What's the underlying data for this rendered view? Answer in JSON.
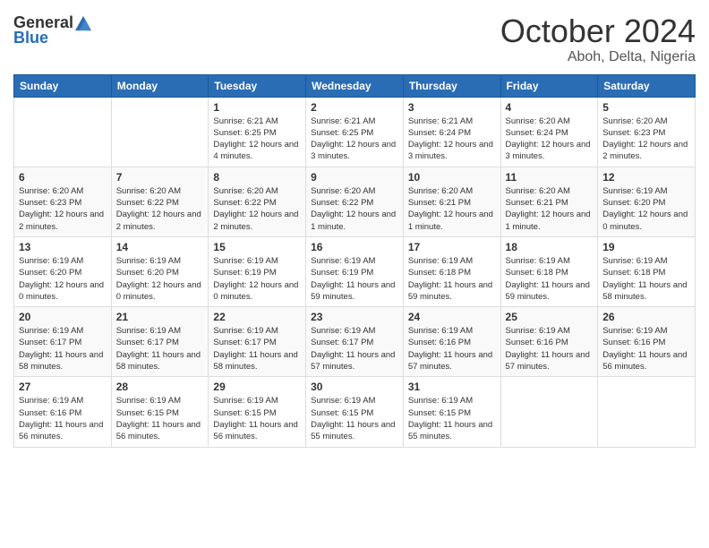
{
  "logo": {
    "general": "General",
    "blue": "Blue"
  },
  "title": {
    "month": "October 2024",
    "location": "Aboh, Delta, Nigeria"
  },
  "weekdays": [
    "Sunday",
    "Monday",
    "Tuesday",
    "Wednesday",
    "Thursday",
    "Friday",
    "Saturday"
  ],
  "weeks": [
    [
      {
        "day": "",
        "info": ""
      },
      {
        "day": "",
        "info": ""
      },
      {
        "day": "1",
        "info": "Sunrise: 6:21 AM\nSunset: 6:25 PM\nDaylight: 12 hours and 4 minutes."
      },
      {
        "day": "2",
        "info": "Sunrise: 6:21 AM\nSunset: 6:25 PM\nDaylight: 12 hours and 3 minutes."
      },
      {
        "day": "3",
        "info": "Sunrise: 6:21 AM\nSunset: 6:24 PM\nDaylight: 12 hours and 3 minutes."
      },
      {
        "day": "4",
        "info": "Sunrise: 6:20 AM\nSunset: 6:24 PM\nDaylight: 12 hours and 3 minutes."
      },
      {
        "day": "5",
        "info": "Sunrise: 6:20 AM\nSunset: 6:23 PM\nDaylight: 12 hours and 2 minutes."
      }
    ],
    [
      {
        "day": "6",
        "info": "Sunrise: 6:20 AM\nSunset: 6:23 PM\nDaylight: 12 hours and 2 minutes."
      },
      {
        "day": "7",
        "info": "Sunrise: 6:20 AM\nSunset: 6:22 PM\nDaylight: 12 hours and 2 minutes."
      },
      {
        "day": "8",
        "info": "Sunrise: 6:20 AM\nSunset: 6:22 PM\nDaylight: 12 hours and 2 minutes."
      },
      {
        "day": "9",
        "info": "Sunrise: 6:20 AM\nSunset: 6:22 PM\nDaylight: 12 hours and 1 minute."
      },
      {
        "day": "10",
        "info": "Sunrise: 6:20 AM\nSunset: 6:21 PM\nDaylight: 12 hours and 1 minute."
      },
      {
        "day": "11",
        "info": "Sunrise: 6:20 AM\nSunset: 6:21 PM\nDaylight: 12 hours and 1 minute."
      },
      {
        "day": "12",
        "info": "Sunrise: 6:19 AM\nSunset: 6:20 PM\nDaylight: 12 hours and 0 minutes."
      }
    ],
    [
      {
        "day": "13",
        "info": "Sunrise: 6:19 AM\nSunset: 6:20 PM\nDaylight: 12 hours and 0 minutes."
      },
      {
        "day": "14",
        "info": "Sunrise: 6:19 AM\nSunset: 6:20 PM\nDaylight: 12 hours and 0 minutes."
      },
      {
        "day": "15",
        "info": "Sunrise: 6:19 AM\nSunset: 6:19 PM\nDaylight: 12 hours and 0 minutes."
      },
      {
        "day": "16",
        "info": "Sunrise: 6:19 AM\nSunset: 6:19 PM\nDaylight: 11 hours and 59 minutes."
      },
      {
        "day": "17",
        "info": "Sunrise: 6:19 AM\nSunset: 6:18 PM\nDaylight: 11 hours and 59 minutes."
      },
      {
        "day": "18",
        "info": "Sunrise: 6:19 AM\nSunset: 6:18 PM\nDaylight: 11 hours and 59 minutes."
      },
      {
        "day": "19",
        "info": "Sunrise: 6:19 AM\nSunset: 6:18 PM\nDaylight: 11 hours and 58 minutes."
      }
    ],
    [
      {
        "day": "20",
        "info": "Sunrise: 6:19 AM\nSunset: 6:17 PM\nDaylight: 11 hours and 58 minutes."
      },
      {
        "day": "21",
        "info": "Sunrise: 6:19 AM\nSunset: 6:17 PM\nDaylight: 11 hours and 58 minutes."
      },
      {
        "day": "22",
        "info": "Sunrise: 6:19 AM\nSunset: 6:17 PM\nDaylight: 11 hours and 58 minutes."
      },
      {
        "day": "23",
        "info": "Sunrise: 6:19 AM\nSunset: 6:17 PM\nDaylight: 11 hours and 57 minutes."
      },
      {
        "day": "24",
        "info": "Sunrise: 6:19 AM\nSunset: 6:16 PM\nDaylight: 11 hours and 57 minutes."
      },
      {
        "day": "25",
        "info": "Sunrise: 6:19 AM\nSunset: 6:16 PM\nDaylight: 11 hours and 57 minutes."
      },
      {
        "day": "26",
        "info": "Sunrise: 6:19 AM\nSunset: 6:16 PM\nDaylight: 11 hours and 56 minutes."
      }
    ],
    [
      {
        "day": "27",
        "info": "Sunrise: 6:19 AM\nSunset: 6:16 PM\nDaylight: 11 hours and 56 minutes."
      },
      {
        "day": "28",
        "info": "Sunrise: 6:19 AM\nSunset: 6:15 PM\nDaylight: 11 hours and 56 minutes."
      },
      {
        "day": "29",
        "info": "Sunrise: 6:19 AM\nSunset: 6:15 PM\nDaylight: 11 hours and 56 minutes."
      },
      {
        "day": "30",
        "info": "Sunrise: 6:19 AM\nSunset: 6:15 PM\nDaylight: 11 hours and 55 minutes."
      },
      {
        "day": "31",
        "info": "Sunrise: 6:19 AM\nSunset: 6:15 PM\nDaylight: 11 hours and 55 minutes."
      },
      {
        "day": "",
        "info": ""
      },
      {
        "day": "",
        "info": ""
      }
    ]
  ]
}
